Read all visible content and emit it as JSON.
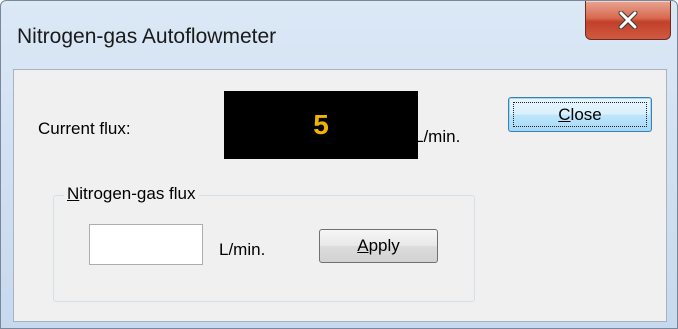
{
  "window": {
    "title": "Nitrogen-gas Autoflowmeter",
    "close_glyph": "✕"
  },
  "current": {
    "label": "Current flux:",
    "value": "5",
    "unit": "L/min."
  },
  "buttons": {
    "close_mnemonic": "C",
    "close_rest": "lose",
    "apply_mnemonic": "A",
    "apply_rest": "pply"
  },
  "group": {
    "legend_mnemonic": "N",
    "legend_rest": "itrogen-gas flux",
    "input_value": "",
    "unit": "L/min."
  },
  "colors": {
    "display_background": "#000000",
    "display_digit": "#f0b400",
    "close_button_red": "#c2402a"
  },
  "icons": {
    "window_close": "close-icon"
  }
}
